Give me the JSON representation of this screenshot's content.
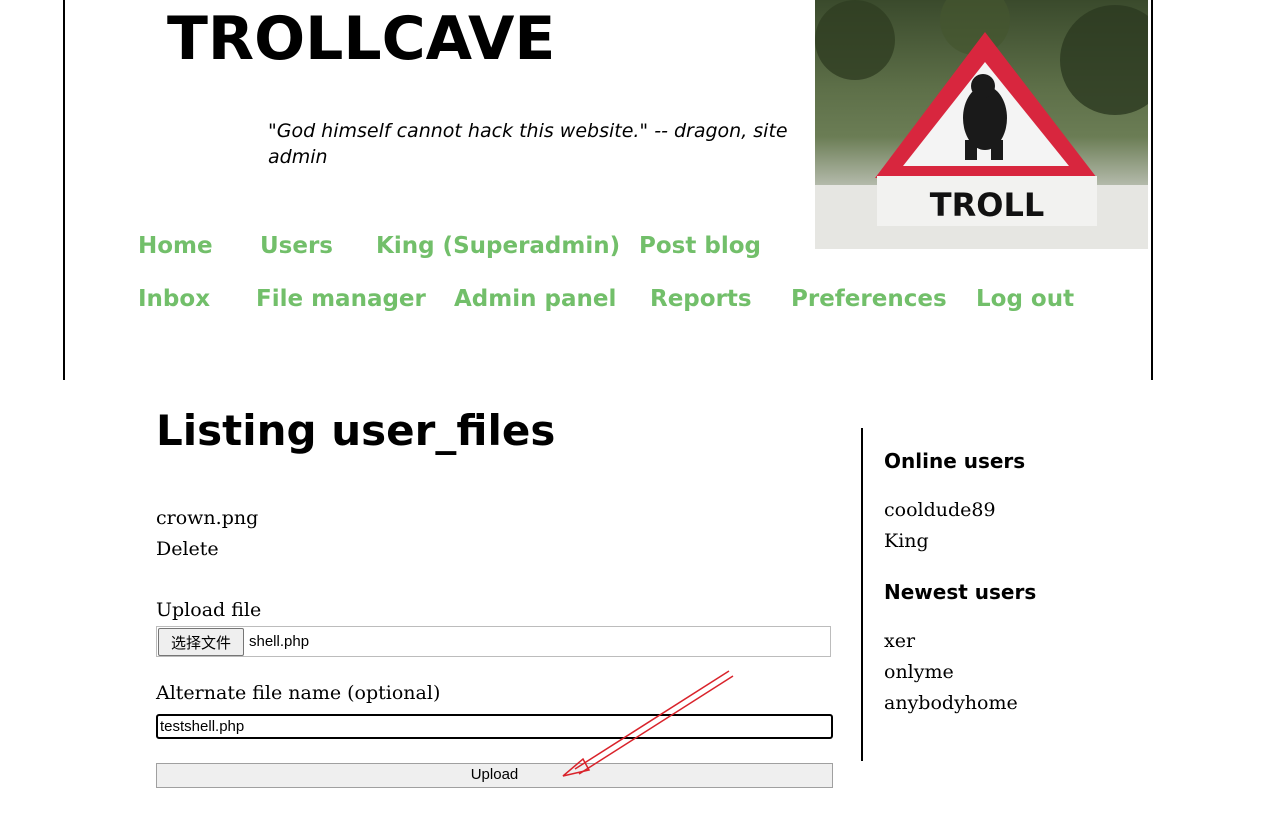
{
  "header": {
    "site_title": "TROLLCAVE",
    "tagline": "\"God himself cannot hack this website.\" -- dragon, site admin",
    "image_text": "TROLL"
  },
  "nav": {
    "row1": [
      "Home",
      "Users",
      "King (Superadmin)",
      "Post blog"
    ],
    "row2": [
      "Inbox",
      "File manager",
      "Admin panel",
      "Reports",
      "Preferences",
      "Log out"
    ]
  },
  "main": {
    "heading": "Listing user_files",
    "files": [
      {
        "name": "crown.png",
        "action": "Delete"
      }
    ],
    "upload": {
      "label": "Upload file",
      "choose_button": "选择文件",
      "chosen_file": "shell.php",
      "alt_label": "Alternate file name (optional)",
      "alt_value": "testshell.php",
      "submit": "Upload"
    }
  },
  "sidebar": {
    "online_heading": "Online users",
    "online_users": [
      "cooldude89",
      "King"
    ],
    "newest_heading": "Newest users",
    "newest_users": [
      "xer",
      "onlyme",
      "anybodyhome"
    ]
  },
  "colors": {
    "nav_link": "#72bf6a",
    "annotation_arrow": "#d9232b"
  }
}
